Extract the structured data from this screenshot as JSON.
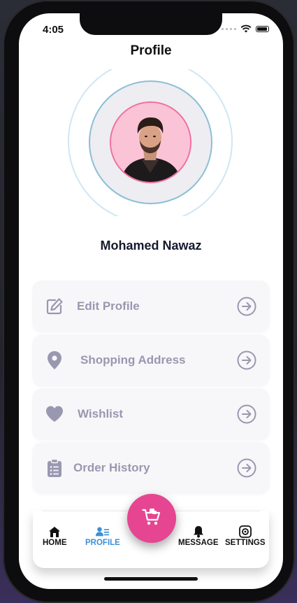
{
  "status_bar": {
    "time": "4:05"
  },
  "header": {
    "title": "Profile"
  },
  "profile": {
    "name": "Mohamed Nawaz",
    "avatar_icon": "user-photo"
  },
  "menu": {
    "items": [
      {
        "label": "Edit Profile",
        "icon": "edit-icon"
      },
      {
        "label": "Shopping Address",
        "icon": "location-pin-icon"
      },
      {
        "label": "Wishlist",
        "icon": "heart-icon"
      },
      {
        "label": "Order History",
        "icon": "clipboard-icon"
      }
    ]
  },
  "tabbar": {
    "items": [
      {
        "label": "HOME",
        "icon": "home-icon",
        "active": false
      },
      {
        "label": "PROFILE",
        "icon": "profile-icon",
        "active": true
      },
      {
        "label": "MESSAGE",
        "icon": "bell-icon",
        "active": false
      },
      {
        "label": "SETTINGS",
        "icon": "settings-icon",
        "active": false
      }
    ],
    "fab_icon": "cart-icon"
  },
  "colors": {
    "accent_pink": "#e64592",
    "active_tab_blue": "#3b8fd9",
    "menu_text": "#9a97b0",
    "menu_card_bg": "#f7f7f9",
    "avatar_bg": "#fbc3d6"
  }
}
